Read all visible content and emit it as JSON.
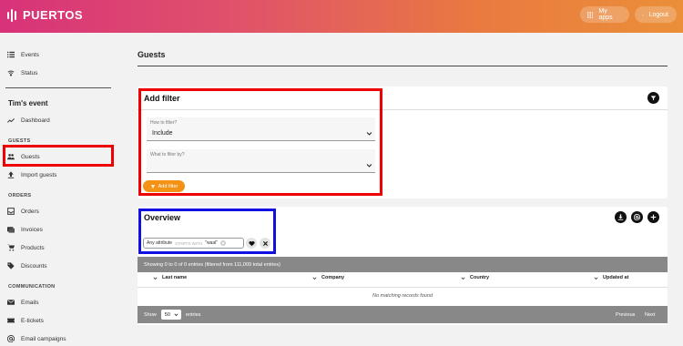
{
  "app": {
    "brand": "PUERTOS"
  },
  "topbar": {
    "my_apps": "My apps",
    "logout": "Logout"
  },
  "sidebar": {
    "top_items": [
      {
        "label": "Events",
        "icon": "list-icon"
      },
      {
        "label": "Status",
        "icon": "wifi-icon"
      }
    ],
    "event_name": "Tim's event",
    "dashboard": "Dashboard",
    "guests_head": "GUESTS",
    "guests_items": [
      {
        "label": "Guests"
      },
      {
        "label": "Import guests"
      }
    ],
    "orders_head": "ORDERS",
    "orders_items": [
      {
        "label": "Orders"
      },
      {
        "label": "Invoices"
      },
      {
        "label": "Products"
      },
      {
        "label": "Discounts"
      }
    ],
    "comm_head": "COMMUNICATION",
    "comm_items": [
      {
        "label": "Emails"
      },
      {
        "label": "E-tickets"
      },
      {
        "label": "Email campaigns"
      }
    ]
  },
  "page": {
    "title": "Guests"
  },
  "filter": {
    "title": "Add filter",
    "how_label": "How to filter?",
    "how_value": "Include",
    "what_label": "What to filter by?",
    "what_value": "",
    "add_button": "Add filter"
  },
  "overview": {
    "title": "Overview",
    "chip_attr": "Any attribute",
    "chip_op": "STARTS WITH",
    "chip_val": "\"waal\"",
    "info": "Showing 0 to 0 of 0 entries (filtered from 111,009 total entries)",
    "columns": [
      "Last name",
      "Company",
      "Country",
      "Updated at"
    ],
    "empty": "No matching records found",
    "show_label": "Show",
    "page_size": "50",
    "entries_label": "entries",
    "prev": "Previous",
    "next": "Next"
  },
  "colors": {
    "accent": "#f39214",
    "brand_start": "#d8327a",
    "brand_end": "#eb8f38",
    "highlight_red": "#e00000",
    "highlight_blue": "#1010e0"
  }
}
